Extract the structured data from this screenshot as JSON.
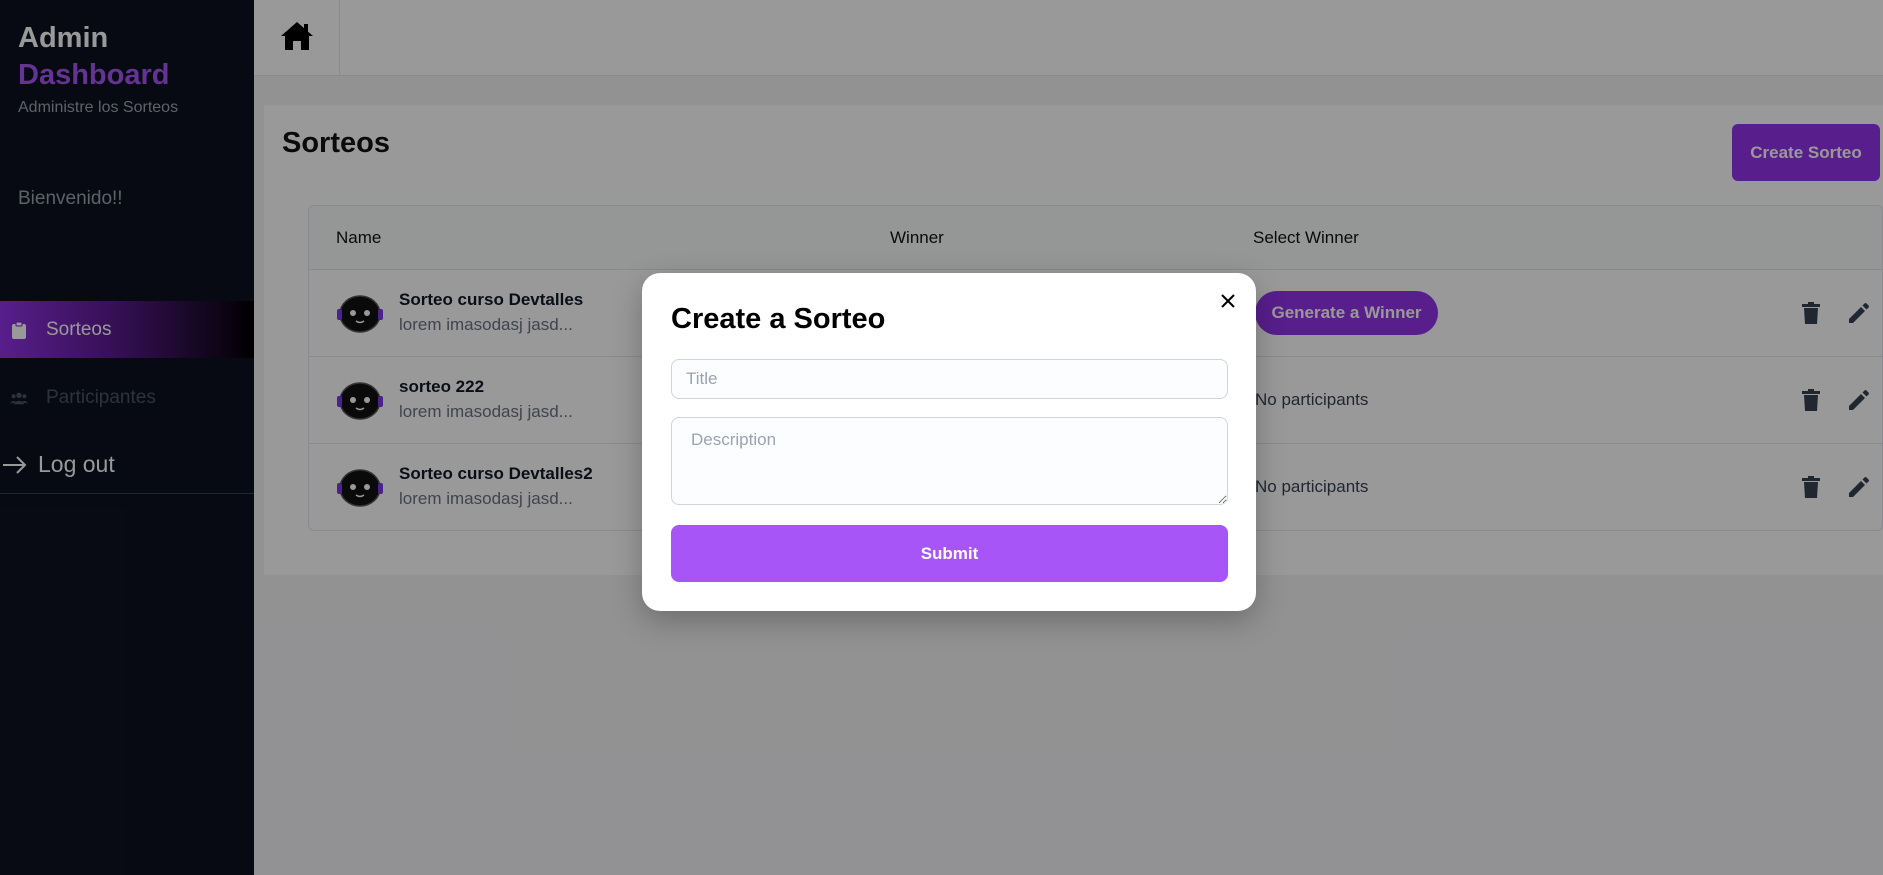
{
  "sidebar": {
    "brand_title": "Admin",
    "brand_accent": "Dashboard",
    "brand_subtitle": "Administre los Sorteos",
    "welcome": "Bienvenido!!",
    "nav": [
      {
        "label": "Sorteos",
        "icon": "clipboard-icon",
        "active": true
      },
      {
        "label": "Participantes",
        "icon": "users-icon",
        "active": false
      }
    ],
    "logout_label": "Log out"
  },
  "topbar": {
    "home_icon": "home-icon"
  },
  "main": {
    "title": "Sorteos",
    "create_button": "Create Sorteo",
    "table": {
      "headers": [
        "Name",
        "Winner",
        "Select Winner"
      ],
      "rows": [
        {
          "name": "Sorteo curso Devtalles",
          "description": "lorem imasodasj jasd...",
          "winner": "",
          "select": "Generate a Winner"
        },
        {
          "name": "sorteo 222",
          "description": "lorem imasodasj jasd...",
          "winner": "",
          "select": "No participants"
        },
        {
          "name": "Sorteo curso Devtalles2",
          "description": "lorem imasodasj jasd...",
          "winner": "",
          "select": "No participants"
        }
      ]
    }
  },
  "modal": {
    "title": "Create a Sorteo",
    "title_placeholder": "Title",
    "title_value": "",
    "description_placeholder": "Description",
    "description_value": "",
    "submit_label": "Submit"
  },
  "colors": {
    "accent": "#9333ea",
    "accent_light": "#a855f7",
    "sidebar_bg": "#0d1220",
    "overlay": "rgba(0,0,0,0.4)"
  }
}
